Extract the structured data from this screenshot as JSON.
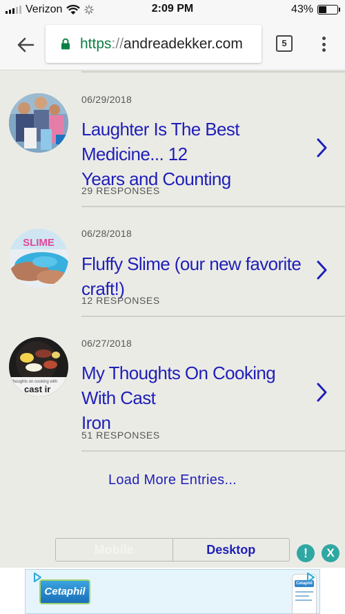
{
  "status_bar": {
    "carrier": "Verizon",
    "time": "2:09 PM",
    "battery_percent": "43%",
    "battery_level": 0.43
  },
  "browser": {
    "url_scheme": "https",
    "url_separator": "://",
    "url_host": "andreadekker.com",
    "tab_count": "5",
    "icons": [
      "back-arrow-icon",
      "lock-icon",
      "tabs-icon",
      "overflow-menu-icon"
    ]
  },
  "entries": [
    {
      "date": "06/29/2018",
      "title": "Laughter Is The Best Medicine... 12 Years and Counting",
      "title_lines": [
        "Laughter Is The Best Medicine... 12",
        "Years and Counting"
      ],
      "responses": "29 RESPONSES"
    },
    {
      "date": "06/28/2018",
      "title": "Fluffy Slime (our new favorite craft!)",
      "title_lines": [
        "Fluffy Slime (our new favorite craft!)"
      ],
      "responses": "12 RESPONSES",
      "thumb_text": "SLIME"
    },
    {
      "date": "06/27/2018",
      "title": "My Thoughts On Cooking With Cast Iron",
      "title_lines": [
        "My Thoughts On Cooking With Cast",
        "Iron"
      ],
      "responses": "51 RESPONSES",
      "thumb_text_small": "thoughts on cooking with",
      "thumb_text_big": "cast ir"
    }
  ],
  "load_more": "Load More Entries...",
  "view_switch": {
    "mobile": "Mobile",
    "desktop": "Desktop",
    "selected": "Desktop"
  },
  "ad": {
    "info_label": "!",
    "close_label": "X",
    "brand": "Cetaphil",
    "bottle_label": "Cetaphil"
  },
  "colors": {
    "link": "#1f1fb8",
    "background": "#ebebe6",
    "secure": "#0b8043",
    "ad_button": "#2fa7a2"
  }
}
